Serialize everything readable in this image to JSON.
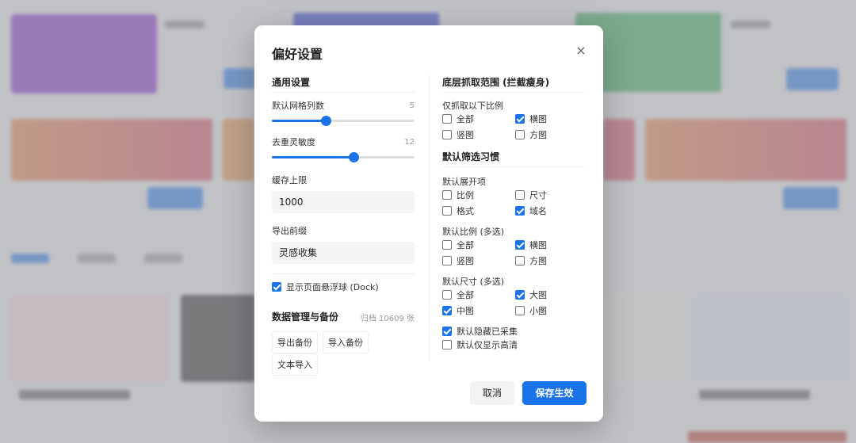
{
  "modal": {
    "title": "偏好设置",
    "close_label": "×",
    "general": {
      "title": "通用设置",
      "grid_columns": {
        "label": "默认网格列数",
        "value": "5",
        "percent": 38
      },
      "dedupe_sensitivity": {
        "label": "去重灵敏度",
        "value": "12",
        "percent": 57
      },
      "cache_limit": {
        "label": "缓存上限",
        "value": "1000"
      },
      "export_prefix": {
        "label": "导出前缀",
        "value": "灵感收集"
      },
      "show_dock": {
        "label": "显示页面悬浮球 (Dock)",
        "checked": true
      }
    },
    "data": {
      "title": "数据管理与备份",
      "count": "归档 10609 张",
      "buttons": [
        "导出备份",
        "导入备份",
        "文本导入"
      ]
    },
    "capture": {
      "title": "底层抓取范围 (拦截瘦身)",
      "subtitle": "仅抓取以下比例",
      "options": [
        {
          "label": "全部",
          "checked": false
        },
        {
          "label": "横图",
          "checked": true
        },
        {
          "label": "竖图",
          "checked": false
        },
        {
          "label": "方图",
          "checked": false
        }
      ]
    },
    "filter": {
      "title": "默认筛选习惯",
      "expand": {
        "label": "默认展开项",
        "options": [
          {
            "label": "比例",
            "checked": false
          },
          {
            "label": "尺寸",
            "checked": false
          },
          {
            "label": "格式",
            "checked": false
          },
          {
            "label": "域名",
            "checked": true
          }
        ]
      },
      "ratio": {
        "label": "默认比例 (多选)",
        "options": [
          {
            "label": "全部",
            "checked": false
          },
          {
            "label": "横图",
            "checked": true
          },
          {
            "label": "竖图",
            "checked": false
          },
          {
            "label": "方图",
            "checked": false
          }
        ]
      },
      "size": {
        "label": "默认尺寸 (多选)",
        "options": [
          {
            "label": "全部",
            "checked": false
          },
          {
            "label": "大图",
            "checked": true
          },
          {
            "label": "中图",
            "checked": true
          },
          {
            "label": "小图",
            "checked": false
          }
        ]
      },
      "hide_collected": {
        "label": "默认隐藏已采集",
        "checked": true
      },
      "show_hd_only": {
        "label": "默认仅显示高清",
        "checked": false
      }
    },
    "footer": {
      "cancel": "取消",
      "save": "保存生效"
    }
  },
  "colors": {
    "accent": "#1a73e8"
  }
}
